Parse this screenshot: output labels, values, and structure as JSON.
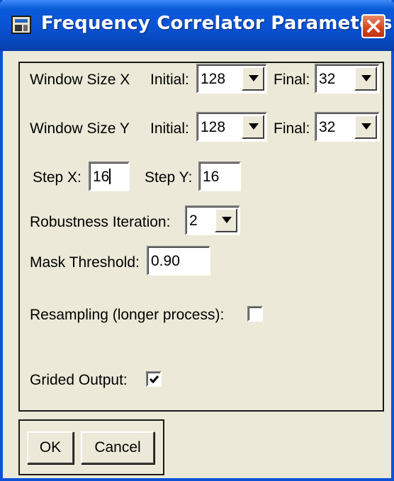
{
  "window": {
    "title": "Frequency Correlator Parameters",
    "app_icon": "dialog-app-icon",
    "close_icon": "close-icon",
    "accent_color": "#0a53d6",
    "close_color": "#d5441e"
  },
  "params": {
    "window_size_x": {
      "label": "Window Size X",
      "initial_label": "Initial:",
      "initial_value": "128",
      "final_label": "Final:",
      "final_value": "32"
    },
    "window_size_y": {
      "label": "Window Size Y",
      "initial_label": "Initial:",
      "initial_value": "128",
      "final_label": "Final:",
      "final_value": "32"
    },
    "step_x": {
      "label": "Step X:",
      "value": "16"
    },
    "step_y": {
      "label": "Step Y:",
      "value": "16"
    },
    "robustness": {
      "label": "Robustness Iteration:",
      "value": "2"
    },
    "mask_threshold": {
      "label": "Mask Threshold:",
      "value": "0.90"
    },
    "resampling": {
      "label": "Resampling (longer process):",
      "checked": false
    },
    "grided_output": {
      "label": "Grided Output:",
      "checked": true
    }
  },
  "buttons": {
    "ok": "OK",
    "cancel": "Cancel"
  }
}
